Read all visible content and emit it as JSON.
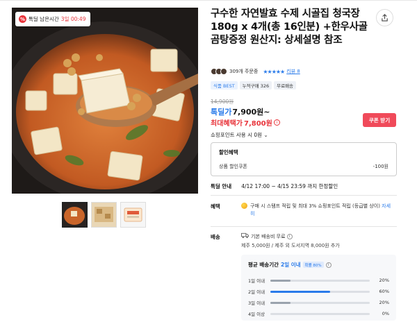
{
  "deal_badge": {
    "label": "톡딜 남은시간",
    "time": "3일 00:49"
  },
  "product": {
    "title": "구수한 자연발효 수제 시골집 청국장 180g x 4개(총 16인분) +한우사골곰탕증정 원산지: 상세설명 참조"
  },
  "reviews": {
    "order_count": "309개 주문중",
    "stars": "★★★★★",
    "review_link": "리뷰 8"
  },
  "tags": [
    {
      "label": "식품 BEST"
    },
    {
      "label": "누적구매 326"
    },
    {
      "label": "무료배송"
    }
  ],
  "price": {
    "original": "14,900원",
    "deal_label": "톡딜가",
    "deal_value": "7,900원~",
    "max_label": "최대혜택가",
    "max_value": "7,800원",
    "info_glyph": "i",
    "coupon_button": "쿠폰 받기",
    "points": "쇼핑포인트 사용 시 0원"
  },
  "discount": {
    "header": "할인혜택",
    "name": "상품 할인쿠폰",
    "amount": "-100원"
  },
  "sale": {
    "label": "톡딜 안내",
    "period": "4/12 17:00 ~ 4/15 23:59 까지 한정할인"
  },
  "benefit": {
    "label": "혜택",
    "text": "구매 시 스탬프 적립 및 최대 3% 쇼핑포인트 적립 (등급별 상이)",
    "link": "자세히"
  },
  "shipping": {
    "label": "배송",
    "free": "기본 배송비 무료",
    "extra": "제주 5,000원 / 제주 외 도서지역 8,000원 추가"
  },
  "delivery": {
    "header": "평균 배송기간",
    "highlight": "2일 이내",
    "badge": "확률 80%",
    "rows": [
      {
        "name": "1일 이내",
        "pct_text": "20%",
        "pct": 20
      },
      {
        "name": "2일 이내",
        "pct_text": "60%",
        "pct": 60
      },
      {
        "name": "3일 이내",
        "pct_text": "20%",
        "pct": 20
      },
      {
        "name": "4일 이상",
        "pct_text": "0%",
        "pct": 0
      }
    ]
  },
  "colors": {
    "accent_blue": "#2a7bea",
    "accent_red": "#e8343b",
    "coupon_bg": "#f04a5a"
  },
  "icons": [
    "percent-icon",
    "share-icon",
    "star-icon",
    "coin-icon",
    "truck-icon",
    "info-icon"
  ]
}
